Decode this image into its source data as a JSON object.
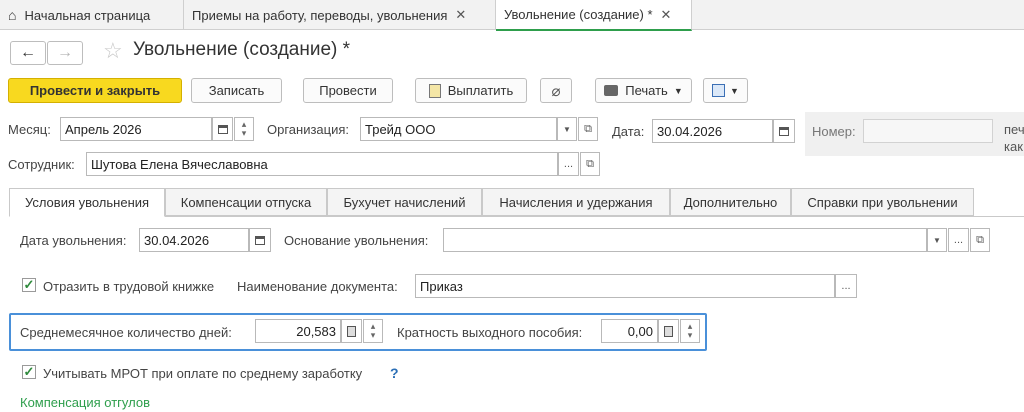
{
  "top_tabs": {
    "home": "Начальная страница",
    "hiring": "Приемы на работу, переводы, увольнения",
    "current": "Увольнение (создание) *",
    "close_glyph": "✕"
  },
  "nav": {
    "back": "←",
    "forward": "→"
  },
  "title": "Увольнение (создание) *",
  "toolbar": {
    "post_close": "Провести и закрыть",
    "save": "Записать",
    "post": "Провести",
    "pay": "Выплатить",
    "print": "Печать"
  },
  "form": {
    "month_label": "Месяц:",
    "month_value": "Апрель 2026",
    "org_label": "Организация:",
    "org_value": "Трейд ООО",
    "date_label": "Дата:",
    "date_value": "30.04.2026",
    "number_label": "Номер:",
    "number_value": "",
    "cut_text_1": "печ",
    "cut_text_2": "как",
    "employee_label": "Сотрудник:",
    "employee_value": "Шутова Елена Вячеславовна"
  },
  "section_tabs": [
    "Условия увольнения",
    "Компенсации отпуска",
    "Бухучет начислений",
    "Начисления и удержания",
    "Дополнительно",
    "Справки при увольнении"
  ],
  "conditions": {
    "dismissal_date_label": "Дата увольнения:",
    "dismissal_date_value": "30.04.2026",
    "reason_label": "Основание увольнения:",
    "reason_value": "",
    "reflect_label": "Отразить в трудовой книжке",
    "reflect_checked": true,
    "docname_label": "Наименование документа:",
    "docname_value": "Приказ",
    "avg_days_label": "Среднемесячное количество дней:",
    "avg_days_value": "20,583",
    "severance_label": "Кратность выходного пособия:",
    "severance_value": "0,00",
    "mrot_label": "Учитывать МРОТ при оплате по среднему заработку",
    "mrot_checked": true,
    "help_mark": "?",
    "compensation_link": "Компенсация отгулов"
  },
  "colors": {
    "primary_button": "#f8d91f",
    "active_tab_underline": "#2e9e4c",
    "focus_border": "#4a90d9",
    "link_green": "#2e9e4c",
    "help_blue": "#2b6fb6"
  }
}
